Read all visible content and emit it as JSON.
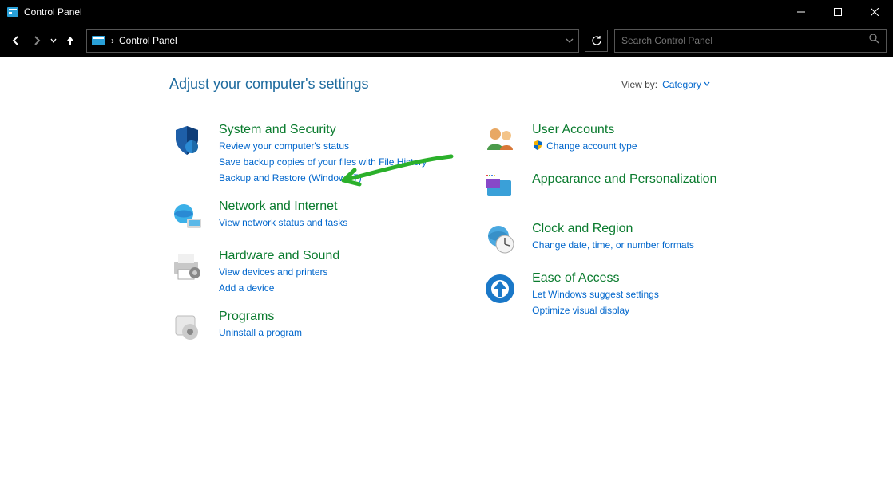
{
  "window": {
    "title": "Control Panel"
  },
  "address": {
    "breadcrumb_sep": "›",
    "location": "Control Panel"
  },
  "search": {
    "placeholder": "Search Control Panel"
  },
  "heading": "Adjust your computer's settings",
  "viewby": {
    "label": "View by:",
    "value": "Category"
  },
  "categories_left": [
    {
      "title": "System and Security",
      "links": [
        "Review your computer's status",
        "Save backup copies of your files with File History",
        "Backup and Restore (Windows 7)"
      ]
    },
    {
      "title": "Network and Internet",
      "links": [
        "View network status and tasks"
      ]
    },
    {
      "title": "Hardware and Sound",
      "links": [
        "View devices and printers",
        "Add a device"
      ]
    },
    {
      "title": "Programs",
      "links": [
        "Uninstall a program"
      ]
    }
  ],
  "categories_right": [
    {
      "title": "User Accounts",
      "links": [
        "Change account type"
      ],
      "shielded": [
        true
      ]
    },
    {
      "title": "Appearance and Personalization",
      "links": []
    },
    {
      "title": "Clock and Region",
      "links": [
        "Change date, time, or number formats"
      ]
    },
    {
      "title": "Ease of Access",
      "links": [
        "Let Windows suggest settings",
        "Optimize visual display"
      ]
    }
  ]
}
